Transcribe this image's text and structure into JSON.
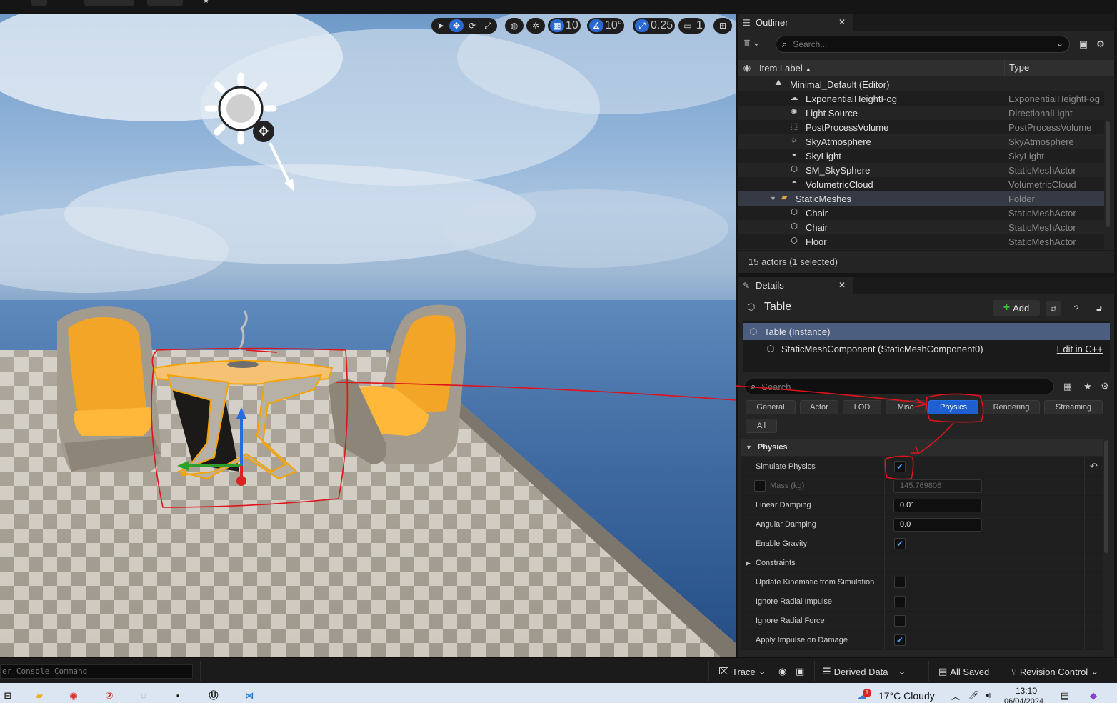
{
  "viewport_toolbar": {
    "grid_snap": "10",
    "rotation_snap": "10°",
    "scale_snap": "0.25",
    "camera_speed": "1"
  },
  "outliner": {
    "tab_title": "Outliner",
    "search_placeholder": "Search...",
    "col_label": "Item Label",
    "col_type": "Type",
    "rows": [
      {
        "label": "Minimal_Default (Editor)",
        "type": "",
        "icon": "level-icon"
      },
      {
        "label": "ExponentialHeightFog",
        "type": "ExponentialHeightFog",
        "icon": "fog-icon"
      },
      {
        "label": "Light Source",
        "type": "DirectionalLight",
        "icon": "sun-icon"
      },
      {
        "label": "PostProcessVolume",
        "type": "PostProcessVolume",
        "icon": "volume-icon"
      },
      {
        "label": "SkyAtmosphere",
        "type": "SkyAtmosphere",
        "icon": "atmosphere-icon"
      },
      {
        "label": "SkyLight",
        "type": "SkyLight",
        "icon": "skylight-icon"
      },
      {
        "label": "SM_SkySphere",
        "type": "StaticMeshActor",
        "icon": "mesh-icon"
      },
      {
        "label": "VolumetricCloud",
        "type": "VolumetricCloud",
        "icon": "cloud-icon"
      },
      {
        "label": "StaticMeshes",
        "type": "Folder",
        "icon": "folder-icon"
      },
      {
        "label": "Chair",
        "type": "StaticMeshActor",
        "icon": "mesh-icon"
      },
      {
        "label": "Chair",
        "type": "StaticMeshActor",
        "icon": "mesh-icon"
      },
      {
        "label": "Floor",
        "type": "StaticMeshActor",
        "icon": "mesh-icon"
      }
    ],
    "footer": "15 actors (1 selected)"
  },
  "details": {
    "tab_title": "Details",
    "object_name": "Table",
    "add_label": "Add",
    "instance_label": "Table (Instance)",
    "component_label": "StaticMeshComponent (StaticMeshComponent0)",
    "edit_cpp": "Edit in C++",
    "search_placeholder": "Search",
    "categories": [
      "General",
      "Actor",
      "LOD",
      "Misc",
      "Physics",
      "Rendering",
      "Streaming",
      "All"
    ],
    "active_category": "Physics",
    "section": "Physics",
    "props": {
      "simulate_physics": "Simulate Physics",
      "mass": "Mass (kg)",
      "mass_value": "145.769806",
      "linear_damping": "Linear Damping",
      "linear_damping_value": "0.01",
      "angular_damping": "Angular Damping",
      "angular_damping_value": "0.0",
      "enable_gravity": "Enable Gravity",
      "constraints": "Constraints",
      "update_kinematic": "Update Kinematic from Simulation",
      "ignore_radial_impulse": "Ignore Radial Impulse",
      "ignore_radial_force": "Ignore Radial Force",
      "apply_impulse": "Apply Impulse on Damage"
    }
  },
  "statusbar": {
    "console_placeholder": "er Console Command",
    "trace": "Trace",
    "derived_data": "Derived Data",
    "all_saved": "All Saved",
    "revision_control": "Revision Control"
  },
  "taskbar": {
    "weather": "17°C  Cloudy",
    "time": "13:10",
    "date": "06/04/2024",
    "notification_count": "1"
  }
}
